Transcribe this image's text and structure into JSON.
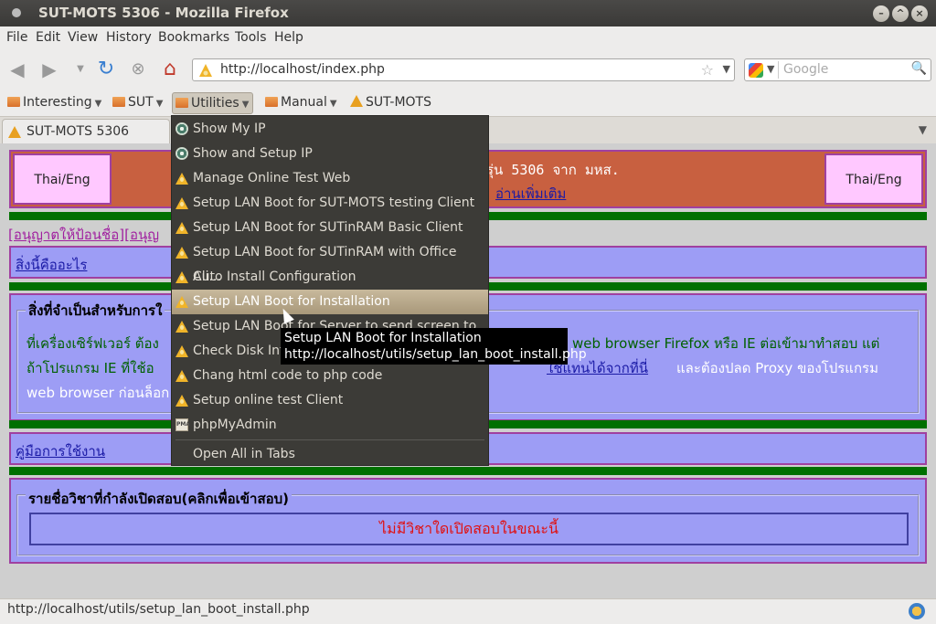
{
  "window": {
    "title": "SUT-MOTS 5306 - Mozilla Firefox"
  },
  "menubar": {
    "items": [
      "File",
      "Edit",
      "View",
      "History",
      "Bookmarks",
      "Tools",
      "Help"
    ]
  },
  "navbar": {
    "url": "http://localhost/index.php",
    "search_placeholder": "Google"
  },
  "bookmarks": {
    "items": [
      {
        "label": "Interesting"
      },
      {
        "label": "SUT"
      },
      {
        "label": "Utilities"
      },
      {
        "label": "Manual"
      },
      {
        "label": "SUT-MOTS"
      }
    ]
  },
  "tab": {
    "title": "SUT-MOTS 5306"
  },
  "dropdown": {
    "items": [
      "Show My IP",
      "Show and Setup IP",
      "Manage Online Test Web",
      "Setup LAN Boot for SUT-MOTS testing Client",
      "Setup LAN Boot for SUTinRAM Basic Client",
      "Setup LAN Boot for SUTinRAM with Office Cli...",
      "Auto Install Configuration",
      "Setup LAN Boot for Installation",
      "Setup LAN Boot for Server to send screen to",
      "Check Disk Int",
      "Chang html code to php code",
      "Setup online test Client",
      "phpMyAdmin"
    ],
    "open_all": "Open All in Tabs",
    "pma_icon_text": "PMA"
  },
  "tooltip": {
    "line1": "Setup LAN Boot for Installation",
    "line2": "http://localhost/utils/setup_lan_boot_install.php"
  },
  "content": {
    "thai_eng": "Thai/Eng",
    "header_text": "รุ่น 5306 จาก มหส.",
    "header_link": "อ่านเพิ่มเติม",
    "permit_links": "[อนุญาตให้ป้อนชื่อ][อนุญ",
    "what_is_this": "สิ่งนี้คืออะไร",
    "required_legend": "สิ่งที่จำเป็นสำหรับการใ",
    "req_line1_a": "ที่เครื่องเซิร์ฟเวอร์ ต้อง",
    "req_line1_b": "web browser Firefox หรือ IE ต่อเข้ามาทำสอบ แต่",
    "req_line2_a": "ถ้าโปรแกรม IE ที่ใช้อ",
    "req_line2_link": "ใช้แทนได้จากที่นี่",
    "req_line2_b": "และต้องปลด Proxy ของโปรแกรม",
    "req_line3": "web browser ก่อนล็อก",
    "manual_link": "คู่มือการใช้งาน",
    "course_legend": "รายชื่อวิชาที่กำลังเปิดสอบ(คลิกเพื่อเข้าสอบ)",
    "no_course": "ไม่มีวิชาใดเปิดสอบในขณะนี้"
  },
  "statusbar": {
    "text": "http://localhost/utils/setup_lan_boot_install.php"
  }
}
